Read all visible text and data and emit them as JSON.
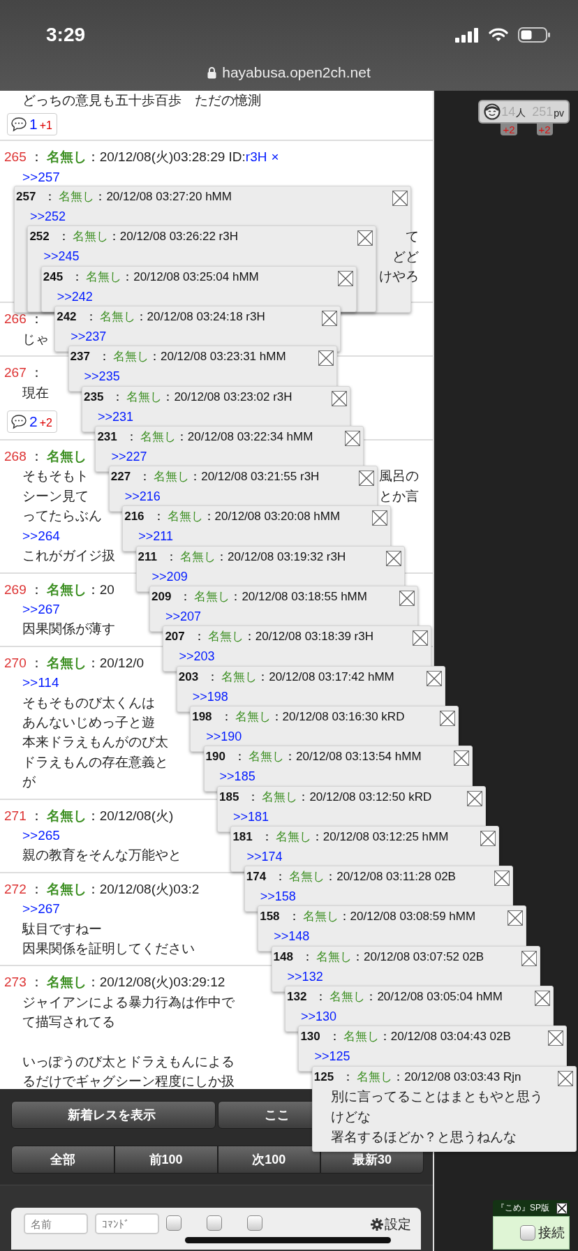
{
  "status_bar": {
    "time": "3:29"
  },
  "address_bar": {
    "url": "hayabusa.open2ch.net"
  },
  "stats": {
    "visitors": "14",
    "visitors_unit": "人",
    "views": "251",
    "views_unit": "pv",
    "visitors_new": "+2",
    "views_new": "+2"
  },
  "thread": {
    "top": {
      "line": "どっちの意見も五十歩百歩　ただの憶測",
      "replies": {
        "count": "1",
        "new": "+1"
      }
    },
    "posts": [
      {
        "number": "265",
        "sep": "：",
        "name": "名無し",
        "date": "：20/12/08(火)03:28:29 ID:",
        "id": "r3H",
        "ng": "×",
        "lines": [
          {
            "kind": "link",
            "text": ">>257"
          },
          {
            "kind": "text",
            "tail": "て"
          },
          {
            "kind": "text",
            "tail": "どど"
          },
          {
            "kind": "text",
            "tail": "けやろ"
          }
        ]
      },
      {
        "number": "266",
        "sep": "：",
        "lines": [
          {
            "kind": "text",
            "text": "じゃ"
          }
        ]
      },
      {
        "number": "267",
        "sep": "：",
        "lines": [
          {
            "kind": "text",
            "text": "現在"
          }
        ],
        "replies": {
          "count": "2",
          "new": "+2"
        }
      },
      {
        "number": "268",
        "sep": "：",
        "name": "名無し",
        "lines": [
          {
            "kind": "text",
            "text": "そもそもト",
            "tail": "風呂の"
          },
          {
            "kind": "text",
            "text": "シーン見て",
            "tail": "とか言"
          },
          {
            "kind": "text",
            "text": "ってたらぶん"
          },
          {
            "kind": "link",
            "text": ">>264"
          },
          {
            "kind": "text",
            "text": "これがガイジ扱"
          }
        ]
      },
      {
        "number": "269",
        "sep": "：",
        "name": "名無し",
        "date": "：20",
        "lines": [
          {
            "kind": "link",
            "text": ">>267"
          },
          {
            "kind": "text",
            "text": "因果関係が薄す"
          }
        ]
      },
      {
        "number": "270",
        "sep": "：",
        "name": "名無し",
        "date": "：20/12/0",
        "lines": [
          {
            "kind": "link",
            "text": ">>114"
          },
          {
            "kind": "text",
            "text": "そもそものび太くんは"
          },
          {
            "kind": "text",
            "text": "あんないじめっ子と遊"
          },
          {
            "kind": "text",
            "text": "本来ドラえもんがのび太"
          },
          {
            "kind": "text",
            "text": "ドラえもんの存在意義と"
          },
          {
            "kind": "text",
            "text": "が"
          }
        ]
      },
      {
        "number": "271",
        "sep": "：",
        "name": "名無し",
        "date": "：20/12/08(火)",
        "lines": [
          {
            "kind": "link",
            "text": ">>265"
          },
          {
            "kind": "text",
            "text": "親の教育をそんな万能やと"
          }
        ]
      },
      {
        "number": "272",
        "sep": "：",
        "name": "名無し",
        "date": "：20/12/08(火)03:2",
        "lines": [
          {
            "kind": "link",
            "text": ">>267"
          },
          {
            "kind": "text",
            "text": "駄目ですねー"
          },
          {
            "kind": "text",
            "text": "因果関係を証明してください"
          }
        ]
      },
      {
        "number": "273",
        "sep": "：",
        "name": "名無し",
        "date": "：20/12/08(火)03:29:12",
        "lines": [
          {
            "kind": "text",
            "text": "ジャイアンによる暴力行為は作中で"
          },
          {
            "kind": "text",
            "text": "て描写されてる"
          },
          {
            "kind": "text",
            "text": "いっぽうのび太とドラえもんによる",
            "blank_before": true
          },
          {
            "kind": "text",
            "text": "るだけでギャグシーン程度にしか扱"
          }
        ]
      }
    ]
  },
  "popups": [
    {
      "number": "257",
      "sep": "：",
      "name": "名無し",
      "date": "：20/12/08 03:27:20 hMM",
      "ref": ">>252"
    },
    {
      "number": "252",
      "sep": "：",
      "name": "名無し",
      "date": "：20/12/08 03:26:22 r3H",
      "ref": ">>245"
    },
    {
      "number": "245",
      "sep": "：",
      "name": "名無し",
      "date": "：20/12/08 03:25:04 hMM",
      "ref": ">>242"
    },
    {
      "number": "242",
      "sep": "：",
      "name": "名無し",
      "date": "：20/12/08 03:24:18 r3H",
      "ref": ">>237"
    },
    {
      "number": "237",
      "sep": "：",
      "name": "名無し",
      "date": "：20/12/08 03:23:31 hMM",
      "ref": ">>235"
    },
    {
      "number": "235",
      "sep": "：",
      "name": "名無し",
      "date": "：20/12/08 03:23:02 r3H",
      "ref": ">>231"
    },
    {
      "number": "231",
      "sep": "：",
      "name": "名無し",
      "date": "：20/12/08 03:22:34 hMM",
      "ref": ">>227"
    },
    {
      "number": "227",
      "sep": "：",
      "name": "名無し",
      "date": "：20/12/08 03:21:55 r3H",
      "ref": ">>216"
    },
    {
      "number": "216",
      "sep": "：",
      "name": "名無し",
      "date": "：20/12/08 03:20:08 hMM",
      "ref": ">>211"
    },
    {
      "number": "211",
      "sep": "：",
      "name": "名無し",
      "date": "：20/12/08 03:19:32 r3H",
      "ref": ">>209"
    },
    {
      "number": "209",
      "sep": "：",
      "name": "名無し",
      "date": "：20/12/08 03:18:55 hMM",
      "ref": ">>207"
    },
    {
      "number": "207",
      "sep": "：",
      "name": "名無し",
      "date": "：20/12/08 03:18:39 r3H",
      "ref": ">>203"
    },
    {
      "number": "203",
      "sep": "：",
      "name": "名無し",
      "date": "：20/12/08 03:17:42 hMM",
      "ref": ">>198"
    },
    {
      "number": "198",
      "sep": "：",
      "name": "名無し",
      "date": "：20/12/08 03:16:30 kRD",
      "ref": ">>190"
    },
    {
      "number": "190",
      "sep": "：",
      "name": "名無し",
      "date": "：20/12/08 03:13:54 hMM",
      "ref": ">>185"
    },
    {
      "number": "185",
      "sep": "：",
      "name": "名無し",
      "date": "：20/12/08 03:12:50 kRD",
      "ref": ">>181"
    },
    {
      "number": "181",
      "sep": "：",
      "name": "名無し",
      "date": "：20/12/08 03:12:25 hMM",
      "ref": ">>174"
    },
    {
      "number": "174",
      "sep": "：",
      "name": "名無し",
      "date": "：20/12/08 03:11:28 02B",
      "ref": ">>158"
    },
    {
      "number": "158",
      "sep": "：",
      "name": "名無し",
      "date": "：20/12/08 03:08:59 hMM",
      "ref": ">>148"
    },
    {
      "number": "148",
      "sep": "：",
      "name": "名無し",
      "date": "：20/12/08 03:07:52 02B",
      "ref": ">>132"
    },
    {
      "number": "132",
      "sep": "：",
      "name": "名無し",
      "date": "：20/12/08 03:05:04 hMM",
      "ref": ">>130"
    },
    {
      "number": "130",
      "sep": "：",
      "name": "名無し",
      "date": "：20/12/08 03:04:43 02B",
      "ref": ">>125"
    },
    {
      "number": "125",
      "sep": "：",
      "name": "名無し",
      "date": "：20/12/08 03:03:43 Rjn",
      "lines": [
        "別に言ってることはまともやと思う",
        "けどな",
        "署名するほどか？と思うねんな"
      ]
    }
  ],
  "buttons": [
    {
      "label": "新着レスを表示"
    },
    {
      "label": "ここ"
    }
  ],
  "pager": [
    {
      "label": "全部"
    },
    {
      "label": "前100"
    },
    {
      "label": "次100"
    },
    {
      "label": "最新30"
    }
  ],
  "form": {
    "name_placeholder": "名前",
    "command_placeholder": "ｺﾏﾝﾄﾞ",
    "checkboxes": [
      {
        "checked": false
      },
      {
        "checked": false
      },
      {
        "checked": false
      }
    ],
    "settings": "設定"
  },
  "kome": {
    "title": "『こめ』SP版",
    "connect": {
      "label": "接続",
      "checked": false
    }
  }
}
